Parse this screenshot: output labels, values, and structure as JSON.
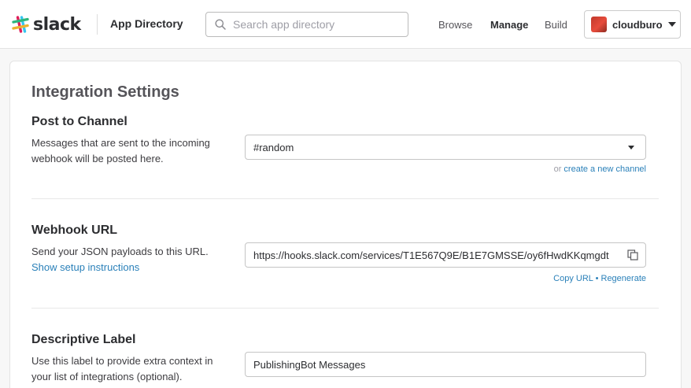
{
  "header": {
    "logo_text": "slack",
    "app_directory": "App Directory",
    "search_placeholder": "Search app directory",
    "nav": {
      "browse": "Browse",
      "manage": "Manage",
      "build": "Build"
    },
    "team_name": "cloudburo"
  },
  "settings": {
    "title": "Integration Settings",
    "post_to_channel": {
      "heading": "Post to Channel",
      "description": "Messages that are sent to the incoming webhook will be posted here.",
      "selected_channel": "#random",
      "or_text": "or ",
      "create_channel_link": "create a new channel"
    },
    "webhook": {
      "heading": "Webhook URL",
      "description": "Send your JSON payloads to this URL.",
      "setup_link": "Show setup instructions",
      "url": "https://hooks.slack.com/services/T1E567Q9E/B1E7GMSSE/oy6fHwdKKqmgdt",
      "copy_url": "Copy URL",
      "separator": "•",
      "regenerate": "Regenerate"
    },
    "descriptive_label": {
      "heading": "Descriptive Label",
      "description": "Use this label to provide extra context in your list of integrations (optional).",
      "value": "PublishingBot Messages"
    }
  },
  "colors": {
    "link": "#2a80b9",
    "text": "#2c2d30",
    "muted": "#9e9ea6"
  },
  "icons": [
    "slack-logo-icon",
    "search-icon",
    "caret-down-icon",
    "copy-icon"
  ]
}
